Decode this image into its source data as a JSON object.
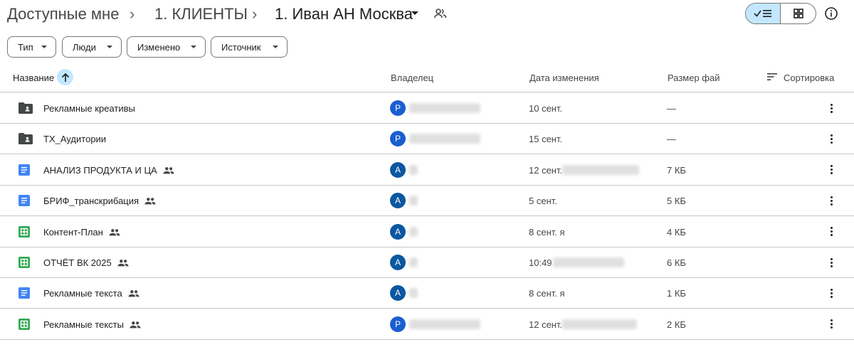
{
  "breadcrumb": {
    "root": "Доступные мне",
    "parent": "1. КЛИЕНТЫ",
    "current": "1. Иван АН Москва"
  },
  "icons": {
    "folder": "shared-folder-icon",
    "doc": "google-docs-icon",
    "sheet": "google-sheets-icon",
    "shared": "people-icon",
    "more": "more-vert-icon"
  },
  "filters": [
    "Тип",
    "Люди",
    "Изменено",
    "Источник"
  ],
  "columns": {
    "name": "Название",
    "owner": "Владелец",
    "modified": "Дата изменения",
    "size": "Размер фай",
    "sort": "Сортировка"
  },
  "colors": {
    "accent": "#c2e7ff",
    "avatar_p": "#1a5fd0",
    "avatar_a": "#0b57a0",
    "doc": "#4285f4",
    "sheet": "#34a853",
    "folder": "#444746"
  },
  "rows": [
    {
      "name": "Рекламные креативы",
      "type": "folder",
      "shared": false,
      "avatar": "P",
      "modified": "10 сент.",
      "size": "—"
    },
    {
      "name": "TX_Аудитории",
      "type": "folder",
      "shared": false,
      "avatar": "P",
      "modified": "15 сент.",
      "size": "—"
    },
    {
      "name": "АНАЛИЗ ПРОДУКТА И ЦА",
      "type": "doc",
      "shared": true,
      "avatar": "A",
      "modified": "12 сент.",
      "size": "7 КБ"
    },
    {
      "name": "БРИФ_транскрибация",
      "type": "doc",
      "shared": true,
      "avatar": "A",
      "modified": "5 сент.",
      "size": "5 КБ"
    },
    {
      "name": "Контент-План",
      "type": "sheet",
      "shared": true,
      "avatar": "A",
      "modified": "8 сент. я",
      "size": "4 КБ"
    },
    {
      "name": "ОТЧЁТ ВК 2025",
      "type": "sheet",
      "shared": true,
      "avatar": "A",
      "modified": "10:49",
      "size": "6 КБ"
    },
    {
      "name": "Рекламные текста",
      "type": "doc",
      "shared": true,
      "avatar": "A",
      "modified": "8 сент. я",
      "size": "1 КБ"
    },
    {
      "name": "Рекламные тексты",
      "type": "sheet",
      "shared": true,
      "avatar": "P",
      "modified": "12 сент.",
      "size": "2 КБ"
    }
  ]
}
